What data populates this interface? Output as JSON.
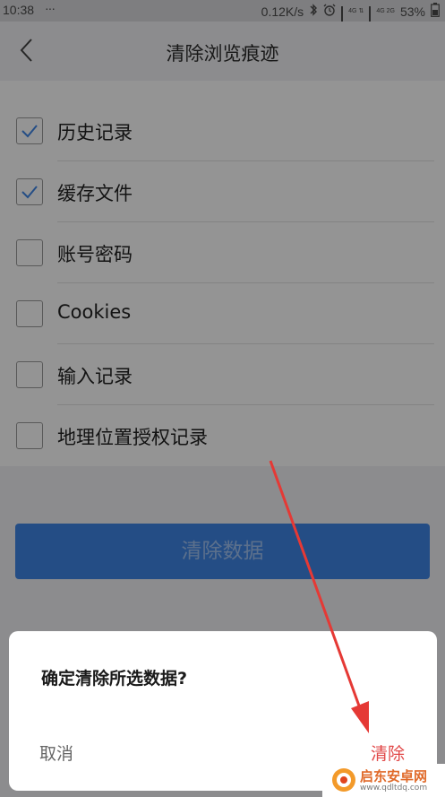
{
  "status_bar": {
    "time": "10:38",
    "dots": "···",
    "speed": "0.12K/s",
    "net_top": "4G",
    "net_bottom": "2G",
    "battery": "53%"
  },
  "header": {
    "title": "清除浏览痕迹",
    "back_icon": "chevron-left-icon"
  },
  "options": [
    {
      "label": "历史记录",
      "checked": true
    },
    {
      "label": "缓存文件",
      "checked": true
    },
    {
      "label": "账号密码",
      "checked": false
    },
    {
      "label": "Cookies",
      "checked": false
    },
    {
      "label": "输入记录",
      "checked": false
    },
    {
      "label": "地理位置授权记录",
      "checked": false
    }
  ],
  "clear_button": {
    "label": "清除数据"
  },
  "dialog": {
    "title": "确定清除所选数据?",
    "cancel": "取消",
    "confirm": "清除"
  },
  "watermark": {
    "brand": "启东安卓网",
    "url": "www.qdltdq.com"
  },
  "colors": {
    "accent": "#3f86e6",
    "confirm": "#e14848",
    "arrow": "#e53935"
  }
}
